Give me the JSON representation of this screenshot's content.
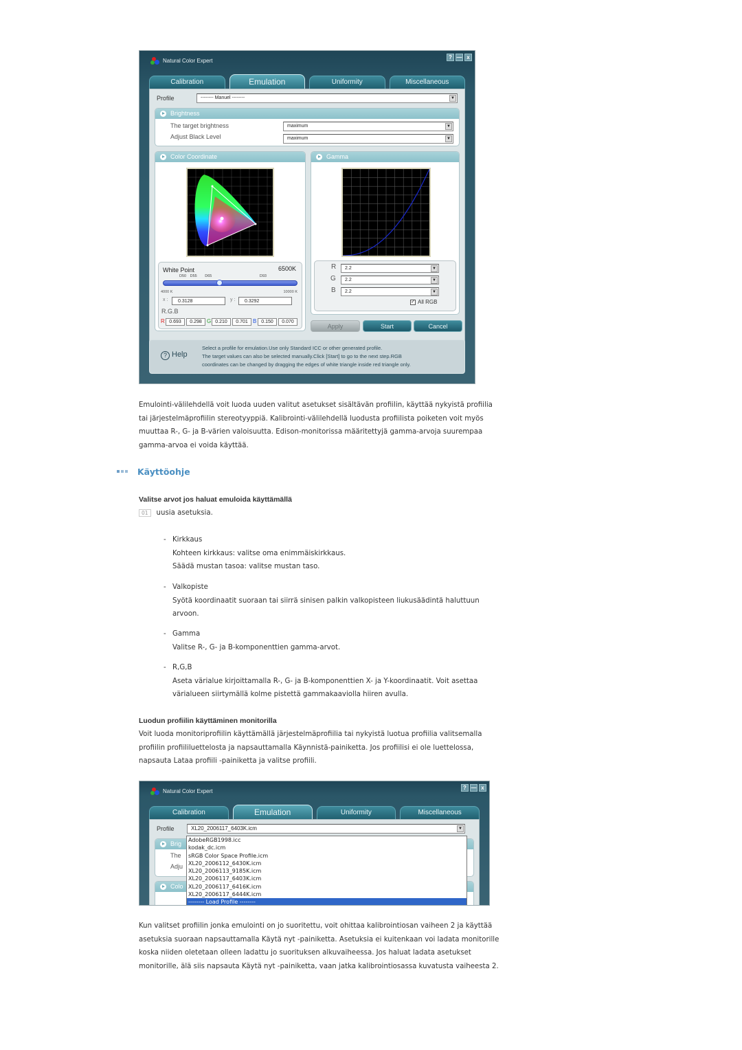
{
  "window1": {
    "app_title": "Natural Color Expert",
    "window_buttons": {
      "help": "?",
      "minimize": "—",
      "close": "x"
    },
    "tabs": [
      {
        "label": "Calibration",
        "active": false
      },
      {
        "label": "Emulation",
        "active": true
      },
      {
        "label": "Uniformity",
        "active": false
      },
      {
        "label": "Miscellaneous",
        "active": false
      }
    ],
    "profile": {
      "label": "Profile",
      "value": "-------- Manuel --------"
    },
    "brightness": {
      "header": "Brightness",
      "target_label": "The target brightness",
      "target_value": "maximum",
      "black_label": "Adjust Black Level",
      "black_value": "maximum"
    },
    "color_coordinate": {
      "header": "Color Coordinate",
      "white_point_label": "White Point",
      "white_point_value": "6500K",
      "slider_marks": [
        "D50",
        "D55",
        "D65",
        "D93"
      ],
      "slider_min": "4000 K",
      "slider_max": "10000 K",
      "slider_fraction": 0.42,
      "x_label": "x :",
      "x_value": "0.3128",
      "y_label": "y :",
      "y_value": "0.3292",
      "rgb_label": "R.G.B",
      "r_label": "R",
      "r_x": "0.693",
      "r_y": "0.298",
      "g_label": "G",
      "g_x": "0.210",
      "g_y": "0.701",
      "b_label": "B",
      "b_x": "0.150",
      "b_y": "0.070"
    },
    "gamma": {
      "header": "Gamma",
      "r_label": "R",
      "r_value": "2.2",
      "g_label": "G",
      "g_value": "2.2",
      "b_label": "B",
      "b_value": "2.2",
      "all_rgb_label": "All RGB",
      "all_rgb_checked": true,
      "curve_gamma": 2.2
    },
    "buttons": {
      "apply": "Apply",
      "start": "Start",
      "cancel": "Cancel"
    },
    "help": {
      "label": "Help",
      "lines": [
        "Select a profile for emulation.Use only Standard ICC or other generated profile.",
        "The target values can also be selected manually.Click [Start] to go to the next step.RGB",
        "coordinates can be changed by dragging the edges of white triangle inside red triangle only."
      ]
    },
    "colors": {
      "accent": "#2b7282",
      "tab_active": "#5aa9b9",
      "window_bg": "#2b5768"
    }
  },
  "intro_paragraph": "Emulointi-välilehdellä voit luoda uuden valitut asetukset sisältävän profiilin, käyttää nykyistä profiilia tai järjestelmäprofiilin stereotyyppiä. Kalibrointi-välilehdellä luodusta profiilista poiketen voit myös muuttaa R-, G- ja B-värien valoisuutta. Edison-monitorissa määritettyjä gamma-arvoja suurempaa gamma-arvoa ei voida käyttää.",
  "section_title": "Käyttöohje",
  "section_color": "#4a8fc2",
  "step1": {
    "title": "Valitse arvot jos haluat emuloida käyttämällä",
    "badge": "01",
    "text": "uusia asetuksia.",
    "items": [
      {
        "dash": "-",
        "title": "Kirkkaus",
        "lines": [
          "Kohteen kirkkaus: valitse oma enimmäiskirkkaus.",
          "Säädä mustan tasoa: valitse mustan taso."
        ]
      },
      {
        "dash": "-",
        "title": "Valkopiste",
        "lines": [
          "Syötä koordinaatit suoraan tai siirrä sinisen palkin valkopisteen liukusäädintä haluttuun arvoon."
        ]
      },
      {
        "dash": "-",
        "title": "Gamma",
        "lines": [
          "Valitse R-, G- ja B-komponenttien gamma-arvot."
        ]
      },
      {
        "dash": "-",
        "title": "R,G,B",
        "lines": [
          "Aseta värialue kirjoittamalla R-, G- ja B-komponenttien X- ja Y-koordinaatit. Voit asettaa värialueen siirtymällä kolme pistettä gammakaaviolla hiiren avulla."
        ]
      }
    ]
  },
  "step2": {
    "title": "Luodun profiilin käyttäminen monitorilla",
    "text": "Voit luoda monitoriprofiilin käyttämällä järjestelmäprofiilia tai nykyistä luotua profiilia valitsemalla profiilin profiililuettelosta ja napsauttamalla Käynnistä-painiketta. Jos profiilisi ei ole luettelossa, napsauta Lataa profiili -painiketta ja valitse profiili."
  },
  "window2": {
    "app_title": "Natural Color Expert",
    "tabs": [
      {
        "label": "Calibration",
        "active": false
      },
      {
        "label": "Emulation",
        "active": true
      },
      {
        "label": "Uniformity",
        "active": false
      },
      {
        "label": "Miscellaneous",
        "active": false
      }
    ],
    "profile": {
      "label": "Profile",
      "value": "XL20_2006117_6403K.icm"
    },
    "behind": {
      "brightness_hdr": "Brig",
      "target": "The",
      "black": "Adju",
      "color_hdr": "Colo"
    },
    "dropdown_options": [
      "AdobeRGB1998.icc",
      "kodak_dc.icm",
      "sRGB Color Space Profile.icm",
      "XL20_2006112_6430K.icm",
      "XL20_2006113_9185K.icm",
      "XL20_2006117_6403K.icm",
      "XL20_2006117_6416K.icm",
      "XL20_2006117_6444K.icm",
      "-------- Load Profile --------"
    ],
    "dropdown_highlighted_index": 8
  },
  "closing_paragraph": "Kun valitset profiilin jonka emulointi on jo suoritettu, voit ohittaa kalibrointiosan vaiheen 2 ja käyttää asetuksia suoraan napsauttamalla Käytä nyt -painiketta. Asetuksia ei kuitenkaan voi ladata monitorille koska niiden oletetaan olleen ladattu jo suorituksen alkuvaiheessa. Jos haluat ladata asetukset monitorille, älä siis napsauta Käytä nyt -painiketta, vaan jatka kalibrointiosassa kuvatusta vaiheesta 2."
}
